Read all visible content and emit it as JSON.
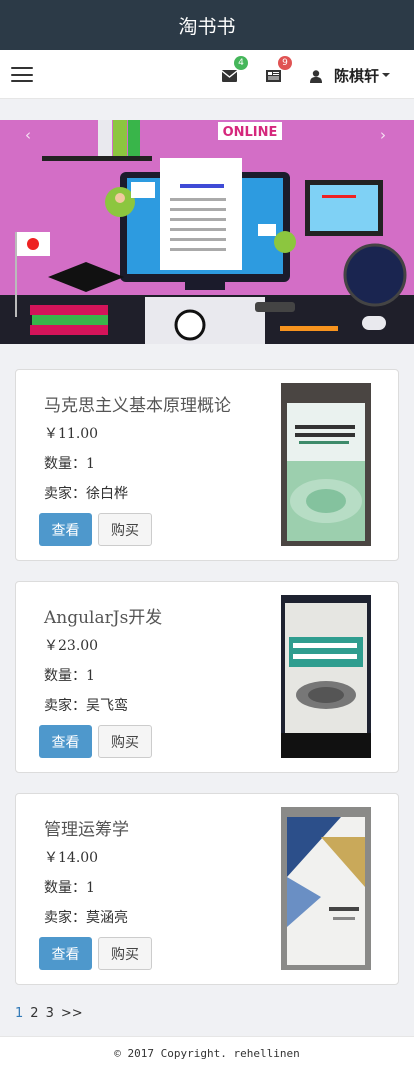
{
  "app": {
    "title": "淘书书"
  },
  "navbar": {
    "mail_badge": "4",
    "news_badge": "9",
    "username": "陈棋轩"
  },
  "carousel": {
    "prev": "‹",
    "next": "›",
    "image_text": "ONLINE"
  },
  "books": [
    {
      "title": "马克思主义基本原理概论",
      "price": "￥11.00",
      "quantity": "数量：1",
      "seller": "卖家：徐白桦",
      "view_label": "查看",
      "buy_label": "购买"
    },
    {
      "title": "AngularJs开发",
      "price": "￥23.00",
      "quantity": "数量：1",
      "seller": "卖家：吴飞鸾",
      "view_label": "查看",
      "buy_label": "购买"
    },
    {
      "title": "管理运筹学",
      "price": "￥14.00",
      "quantity": "数量：1",
      "seller": "卖家：莫涵亮",
      "view_label": "查看",
      "buy_label": "购买"
    }
  ],
  "pagination": {
    "pages": [
      "1",
      "2",
      "3"
    ],
    "next": ">>"
  },
  "footer": {
    "copyright": "© 2017 Copyright. rehellinen"
  },
  "colors": {
    "topbar": "#2c3a47",
    "primary": "#4e98cc",
    "badge_green": "#45b65a",
    "badge_red": "#e05353"
  }
}
